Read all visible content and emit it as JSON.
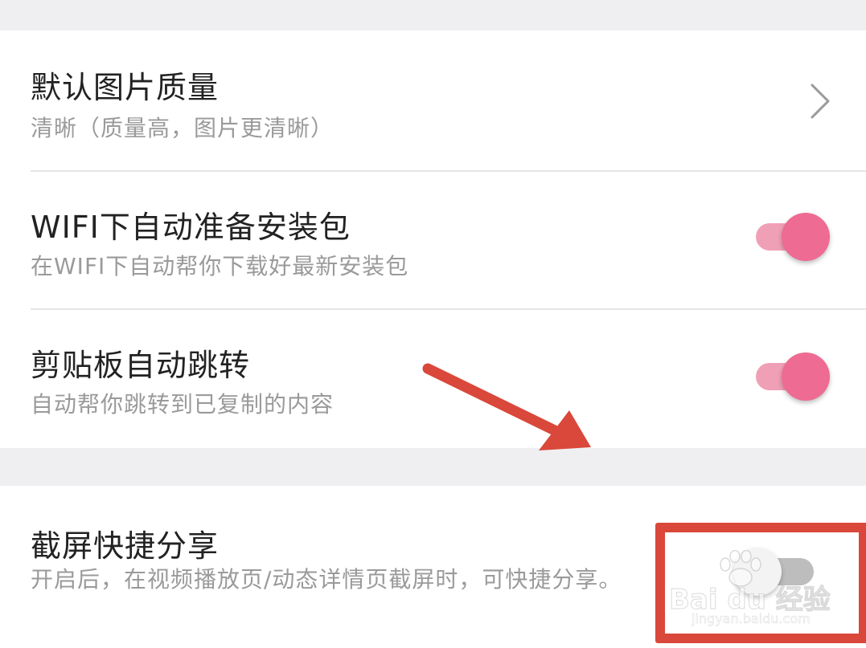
{
  "settings": [
    {
      "title": "默认图片质量",
      "subtitle": "清晰（质量高，图片更清晰）",
      "control": "chevron-right-icon"
    },
    {
      "title": "WIFI下自动准备安装包",
      "subtitle": "在WIFI下自动帮你下载好最新安装包",
      "control": "toggle",
      "enabled": true
    },
    {
      "title": "剪贴板自动跳转",
      "subtitle": "自动帮你跳转到已复制的内容",
      "control": "toggle",
      "enabled": true
    },
    {
      "title": "截屏快捷分享",
      "subtitle": "开启后，在视频播放页/动态详情页截屏时，可快捷分享。",
      "control": "toggle",
      "enabled": false
    }
  ],
  "watermark": {
    "brand": "Bai du 经验",
    "url": "jingyan.baidu.com"
  },
  "colors": {
    "accent": "#ee6b93",
    "accent_track": "#f0a0b6",
    "annotation": "#d9483a",
    "page_bg": "#efeff1"
  }
}
